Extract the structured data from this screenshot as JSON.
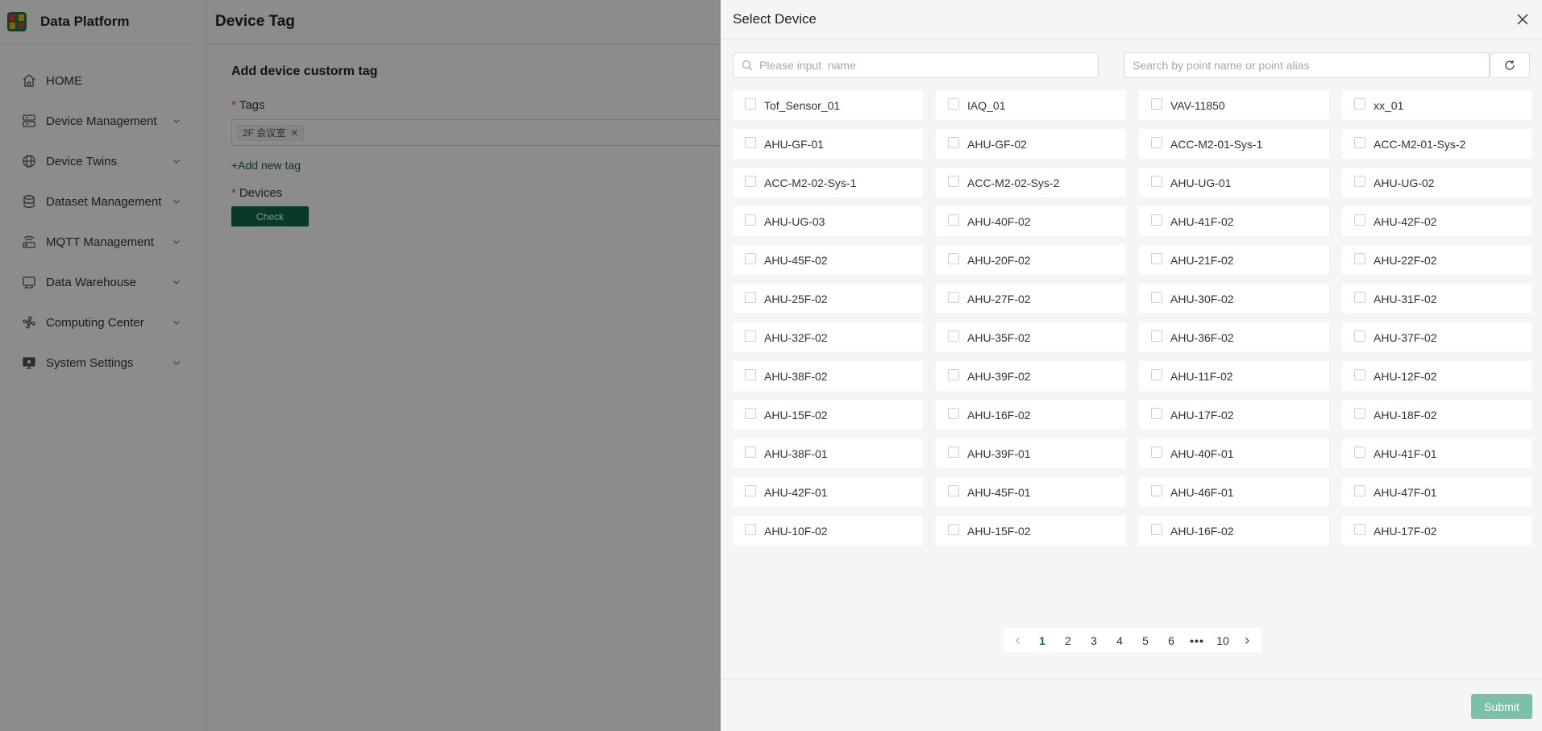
{
  "app": {
    "title": "Data Platform"
  },
  "sidebar": {
    "items": [
      {
        "label": "HOME",
        "icon": "home-icon",
        "has_children": false
      },
      {
        "label": "Device Management",
        "icon": "server-icon",
        "has_children": true
      },
      {
        "label": "Device Twins",
        "icon": "globe-icon",
        "has_children": true
      },
      {
        "label": "Dataset Management",
        "icon": "database-icon",
        "has_children": true
      },
      {
        "label": "MQTT Management",
        "icon": "router-icon",
        "has_children": true
      },
      {
        "label": "Data Warehouse",
        "icon": "warehouse-icon",
        "has_children": true
      },
      {
        "label": "Computing Center",
        "icon": "fan-icon",
        "has_children": true
      },
      {
        "label": "System Settings",
        "icon": "monitor-icon",
        "has_children": true
      }
    ]
  },
  "header": {
    "title": "Device Tag"
  },
  "form": {
    "section_title": "Add device custorm tag",
    "tags_label": "Tags",
    "tag_chip": "2F 会议室",
    "add_tag_label": "+Add new tag",
    "devices_label": "Devices",
    "check_label": "Check"
  },
  "drawer": {
    "title": "Select Device",
    "search_name_placeholder": "Please input  name",
    "search_point_placeholder": "Search by point name or point alias",
    "devices": [
      "Tof_Sensor_01",
      "IAQ_01",
      "VAV-11850",
      "xx_01",
      "AHU-GF-01",
      "AHU-GF-02",
      "ACC-M2-01-Sys-1",
      "ACC-M2-01-Sys-2",
      "ACC-M2-02-Sys-1",
      "ACC-M2-02-Sys-2",
      "AHU-UG-01",
      "AHU-UG-02",
      "AHU-UG-03",
      "AHU-40F-02",
      "AHU-41F-02",
      "AHU-42F-02",
      "AHU-45F-02",
      "AHU-20F-02",
      "AHU-21F-02",
      "AHU-22F-02",
      "AHU-25F-02",
      "AHU-27F-02",
      "AHU-30F-02",
      "AHU-31F-02",
      "AHU-32F-02",
      "AHU-35F-02",
      "AHU-36F-02",
      "AHU-37F-02",
      "AHU-38F-02",
      "AHU-39F-02",
      "AHU-11F-02",
      "AHU-12F-02",
      "AHU-15F-02",
      "AHU-16F-02",
      "AHU-17F-02",
      "AHU-18F-02",
      "AHU-38F-01",
      "AHU-39F-01",
      "AHU-40F-01",
      "AHU-41F-01",
      "AHU-42F-01",
      "AHU-45F-01",
      "AHU-46F-01",
      "AHU-47F-01",
      "AHU-10F-02",
      "AHU-15F-02",
      "AHU-16F-02",
      "AHU-17F-02"
    ],
    "pagination": {
      "current": "1",
      "pages": [
        "1",
        "2",
        "3",
        "4",
        "5",
        "6",
        "•••",
        "10"
      ]
    },
    "submit_label": "Submit"
  },
  "colors": {
    "brand": "#0f6b4f",
    "submit_disabled": "#7cc0ab",
    "required": "#e5484d"
  }
}
